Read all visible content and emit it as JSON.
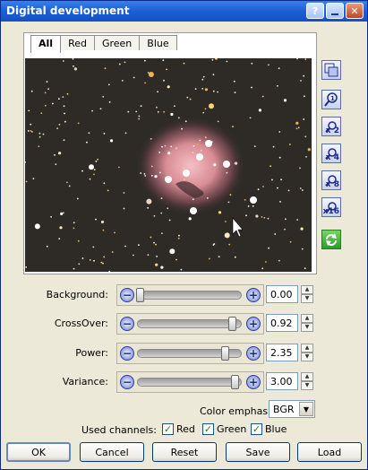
{
  "window": {
    "title": "Digital development"
  },
  "tabs": [
    {
      "label": "All"
    },
    {
      "label": "Red"
    },
    {
      "label": "Green"
    },
    {
      "label": "Blue"
    }
  ],
  "tools": [
    {
      "icon": "fit-to-window-icon",
      "label": ""
    },
    {
      "icon": "zoom-1x-icon",
      "label": ""
    },
    {
      "icon": "zoom-2x-icon",
      "label": "x 2"
    },
    {
      "icon": "zoom-4x-icon",
      "label": "x 4"
    },
    {
      "icon": "zoom-8x-icon",
      "label": "x 8"
    },
    {
      "icon": "zoom-16x-icon",
      "label": "x16"
    },
    {
      "icon": "refresh-icon",
      "label": ""
    }
  ],
  "sliders": [
    {
      "label": "Background:",
      "value": "0.00",
      "fraction": 0.02
    },
    {
      "label": "CrossOver:",
      "value": "0.92",
      "fraction": 0.91
    },
    {
      "label": "Power:",
      "value": "2.35",
      "fraction": 0.84
    },
    {
      "label": "Variance:",
      "value": "3.00",
      "fraction": 0.94
    }
  ],
  "color_emphasis": {
    "label": "Color emphasis:",
    "value": "BGR"
  },
  "channels": {
    "label": "Used channels:",
    "items": [
      {
        "label": "Red",
        "checked": true
      },
      {
        "label": "Green",
        "checked": true
      },
      {
        "label": "Blue",
        "checked": true
      }
    ]
  },
  "buttons": {
    "ok": "OK",
    "cancel": "Cancel",
    "reset": "Reset",
    "save": "Save",
    "load": "Load"
  }
}
